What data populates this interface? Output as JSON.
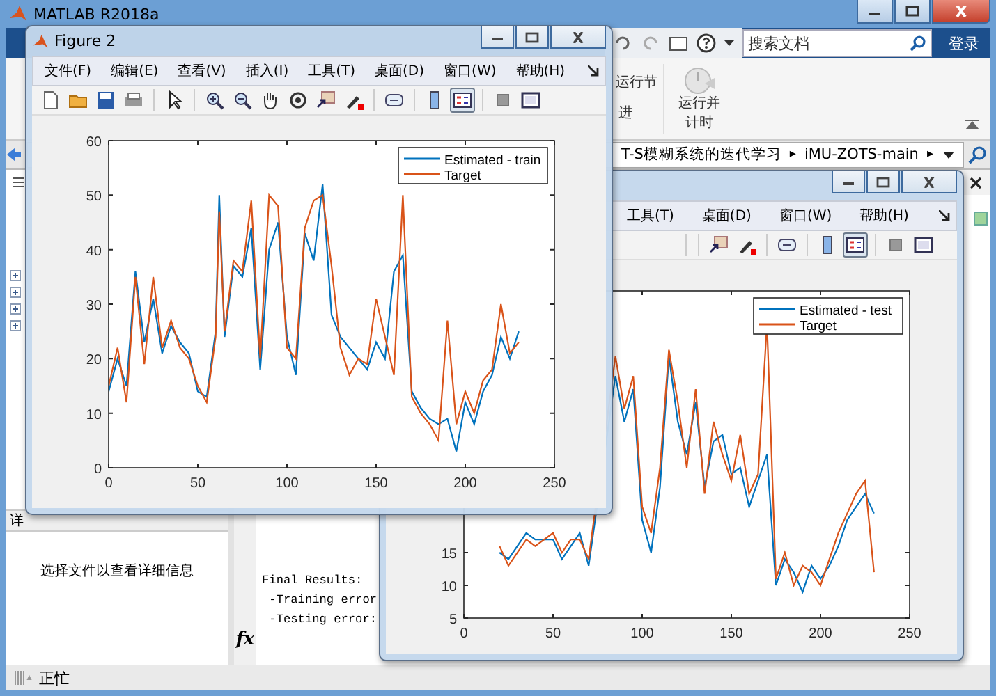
{
  "window": {
    "title": "MATLAB R2018a"
  },
  "search": {
    "placeholder": "搜索文档"
  },
  "login": "登录",
  "ribbon": [
    {
      "label": "运行节"
    },
    {
      "label": "进"
    },
    {
      "label": "运行并计时"
    }
  ],
  "address_bar": {
    "separator": "▸",
    "path": [
      "T-S模糊系统的迭代学习",
      "iMU-ZOTS-main"
    ]
  },
  "details_panel": {
    "header": "详",
    "message": "选择文件以查看详细信息"
  },
  "command_window": {
    "prompt": "fx",
    "lines": [
      "Final Results:",
      " -Training error",
      " -Testing error:"
    ]
  },
  "status_bar": {
    "text": "正忙"
  },
  "figures": [
    {
      "title": "Figure 2",
      "menu": [
        "文件(F)",
        "编辑(E)",
        "查看(V)",
        "插入(I)",
        "工具(T)",
        "桌面(D)",
        "窗口(W)",
        "帮助(H)"
      ],
      "legend_pressed": true,
      "chart_data": {
        "type": "line",
        "legend": true,
        "xlim": [
          0,
          250
        ],
        "ylim": [
          0,
          60
        ],
        "xticks": [
          0,
          50,
          100,
          150,
          200,
          250
        ],
        "yticks": [
          0,
          10,
          20,
          30,
          40,
          50,
          60
        ],
        "x": [
          0,
          5,
          10,
          15,
          20,
          25,
          30,
          35,
          40,
          45,
          50,
          55,
          60,
          62,
          65,
          70,
          75,
          80,
          85,
          90,
          95,
          100,
          105,
          110,
          115,
          120,
          125,
          130,
          135,
          140,
          145,
          150,
          155,
          160,
          165,
          170,
          175,
          180,
          185,
          190,
          195,
          200,
          205,
          210,
          215,
          220,
          225,
          230
        ],
        "series": [
          {
            "name": "Estimated - train",
            "color": "#0072bd",
            "values": [
              14,
              20,
              15,
              36,
              23,
              31,
              21,
              26,
              23,
              21,
              14,
              13,
              25,
              50,
              24,
              37,
              35,
              44,
              18,
              40,
              45,
              24,
              17,
              43,
              38,
              52,
              28,
              24,
              22,
              20,
              18,
              23,
              20,
              36,
              39,
              14,
              11,
              9,
              8,
              9,
              3,
              12,
              8,
              14,
              17,
              24,
              20,
              25
            ]
          },
          {
            "name": "Target",
            "color": "#d95319",
            "values": [
              15,
              22,
              12,
              35,
              19,
              35,
              22,
              27,
              22,
              20,
              15,
              12,
              24,
              47,
              25,
              38,
              36,
              49,
              20,
              50,
              48,
              22,
              20,
              44,
              49,
              50,
              37,
              22,
              17,
              20,
              19,
              31,
              24,
              17,
              50,
              13,
              10,
              8,
              5,
              27,
              8,
              14,
              10,
              16,
              18,
              30,
              21,
              23
            ]
          }
        ]
      }
    },
    {
      "menu": [
        "工具(T)",
        "桌面(D)",
        "窗口(W)",
        "帮助(H)"
      ],
      "legend_pressed": true,
      "chart_data": {
        "type": "line",
        "legend": true,
        "xlim": [
          0,
          250
        ],
        "ylim": [
          5,
          55
        ],
        "xticks": [
          0,
          50,
          100,
          150,
          200,
          250
        ],
        "yticks": [
          5,
          10,
          15
        ],
        "x": [
          20,
          25,
          35,
          40,
          50,
          55,
          60,
          65,
          70,
          85,
          90,
          95,
          100,
          105,
          110,
          115,
          120,
          125,
          130,
          135,
          140,
          145,
          150,
          155,
          160,
          165,
          170,
          175,
          180,
          185,
          190,
          195,
          200,
          205,
          210,
          215,
          220,
          225,
          230
        ],
        "series": [
          {
            "name": "Estimated - test",
            "color": "#0072bd",
            "values": [
              15,
              14,
              18,
              17,
              17,
              14,
              16,
              18,
              13,
              42,
              35,
              40,
              20,
              15,
              25,
              45,
              35,
              30,
              38,
              25,
              32,
              33,
              27,
              28,
              22,
              26,
              30,
              10,
              14,
              12,
              9,
              13,
              11,
              13,
              16,
              20,
              22,
              24,
              21
            ]
          },
          {
            "name": "Target",
            "color": "#d95319",
            "values": [
              16,
              13,
              17,
              16,
              18,
              15,
              17,
              17,
              14,
              45,
              37,
              42,
              22,
              18,
              28,
              46,
              38,
              28,
              40,
              24,
              35,
              30,
              26,
              33,
              24,
              27,
              50,
              11,
              15,
              10,
              13,
              12,
              10,
              14,
              18,
              21,
              24,
              26,
              12
            ]
          }
        ]
      }
    }
  ]
}
